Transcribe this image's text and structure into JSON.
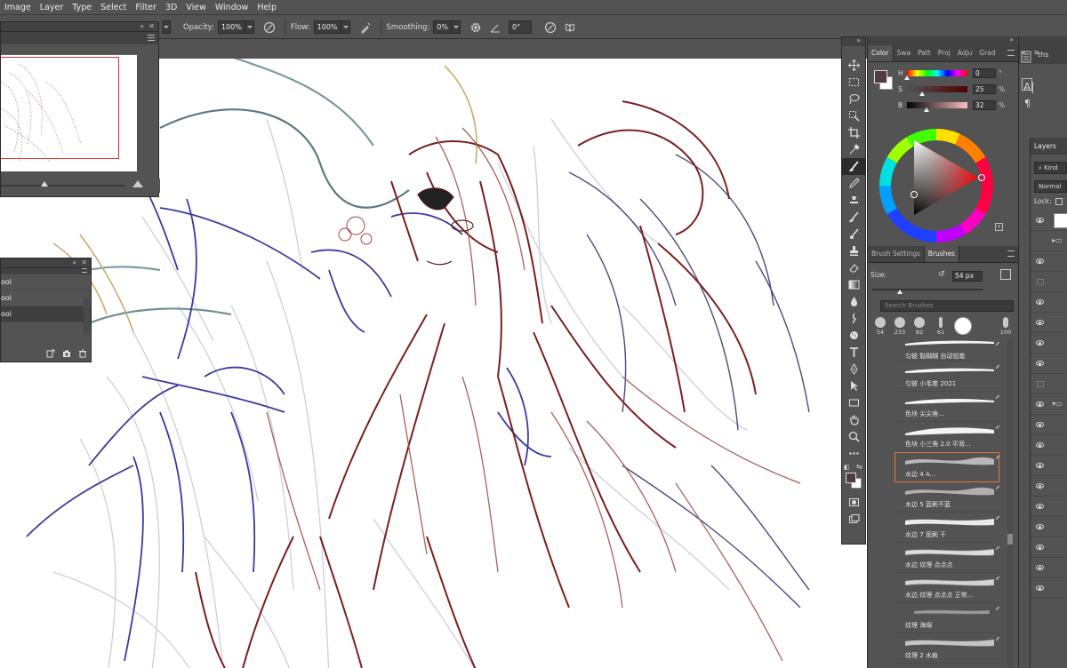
{
  "menu": {
    "items": [
      "Image",
      "Layer",
      "Type",
      "Select",
      "Filter",
      "3D",
      "View",
      "Window",
      "Help"
    ]
  },
  "options": {
    "opacity_label": "Opacity:",
    "opacity_value": "100%",
    "flow_label": "Flow:",
    "flow_value": "100%",
    "smoothing_label": "Smoothing:",
    "smoothing_value": "0%",
    "angle_value": "0°"
  },
  "history": {
    "rows": [
      "ool",
      "ool",
      "ool"
    ]
  },
  "color_panel": {
    "tabs": [
      "Color",
      "Swa",
      "Patt",
      "Proj",
      "Adju",
      "Grad"
    ],
    "h_label": "H",
    "h_value": "0",
    "h_unit": "°",
    "s_label": "S",
    "s_value": "25",
    "s_unit": "%",
    "b_label": "B",
    "b_value": "32",
    "b_unit": "%",
    "foreground_color": "#513c43"
  },
  "brush_panel": {
    "tabs": [
      "Brush Settings",
      "Brushes"
    ],
    "size_label": "Size:",
    "size_value": "54 px",
    "search_placeholder": "Search Brushes",
    "recent_sizes": [
      "54",
      "233",
      "82",
      "61",
      "",
      "100"
    ],
    "brushes": [
      {
        "name": "匀彼 黏糊糊 自动铅笔"
      },
      {
        "name": "匀彼 小毛笔 2021"
      },
      {
        "name": "色块 尖尖角..."
      },
      {
        "name": "色块 小三角 2.0 平滑..."
      },
      {
        "name": "水边 4 A..."
      },
      {
        "name": "水边 5 蓝刷不蓝"
      },
      {
        "name": "水边 7 宽刷 干"
      },
      {
        "name": "水边 纹理 点点点"
      },
      {
        "name": "水边 纹理 点点点 正常..."
      },
      {
        "name": "纹理 海绵"
      },
      {
        "name": "纹理 2 水痕"
      }
    ],
    "selected_index": 4
  },
  "far_right": {
    "tab_label": "ths",
    "layers_tab": "Layers",
    "kind_label": "Kind",
    "blend_mode": "Normal",
    "lock_label": "Lock:"
  }
}
